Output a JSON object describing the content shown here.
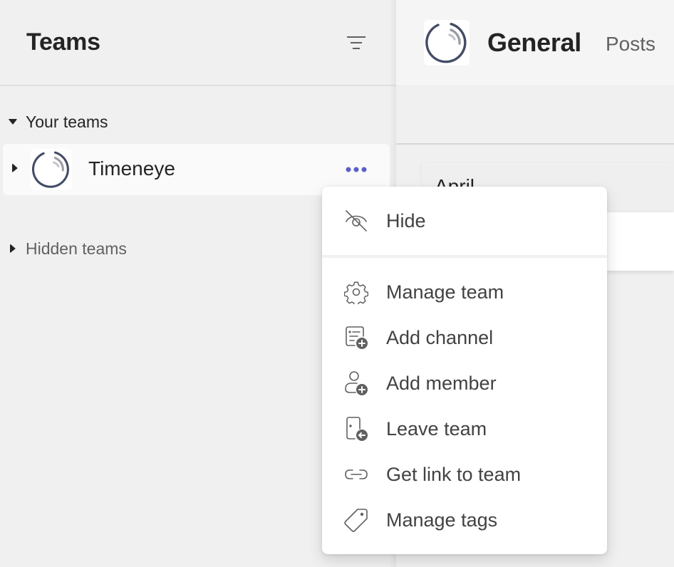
{
  "sidebar": {
    "title": "Teams",
    "filter_icon": "filter-icon",
    "sections": [
      {
        "label": "Your teams",
        "expanded": true
      },
      {
        "label": "Hidden teams",
        "expanded": false
      }
    ],
    "teams": [
      {
        "name": "Timeneye",
        "more_icon": "more-horizontal-icon"
      }
    ]
  },
  "channel": {
    "title": "General",
    "tabs": [
      {
        "label": "Posts"
      }
    ],
    "date_label": "April"
  },
  "context_menu": {
    "items": [
      {
        "label": "Hide",
        "icon": "eye-off-icon"
      },
      {
        "label": "Manage team",
        "icon": "gear-icon"
      },
      {
        "label": "Add channel",
        "icon": "add-channel-icon"
      },
      {
        "label": "Add member",
        "icon": "add-person-icon"
      },
      {
        "label": "Leave team",
        "icon": "leave-team-icon"
      },
      {
        "label": "Get link to team",
        "icon": "link-icon"
      },
      {
        "label": "Manage tags",
        "icon": "tag-icon"
      }
    ]
  },
  "colors": {
    "accent": "#5b5fc7",
    "logo_ring": "#434c66",
    "logo_arc": "#9a9ca6"
  }
}
